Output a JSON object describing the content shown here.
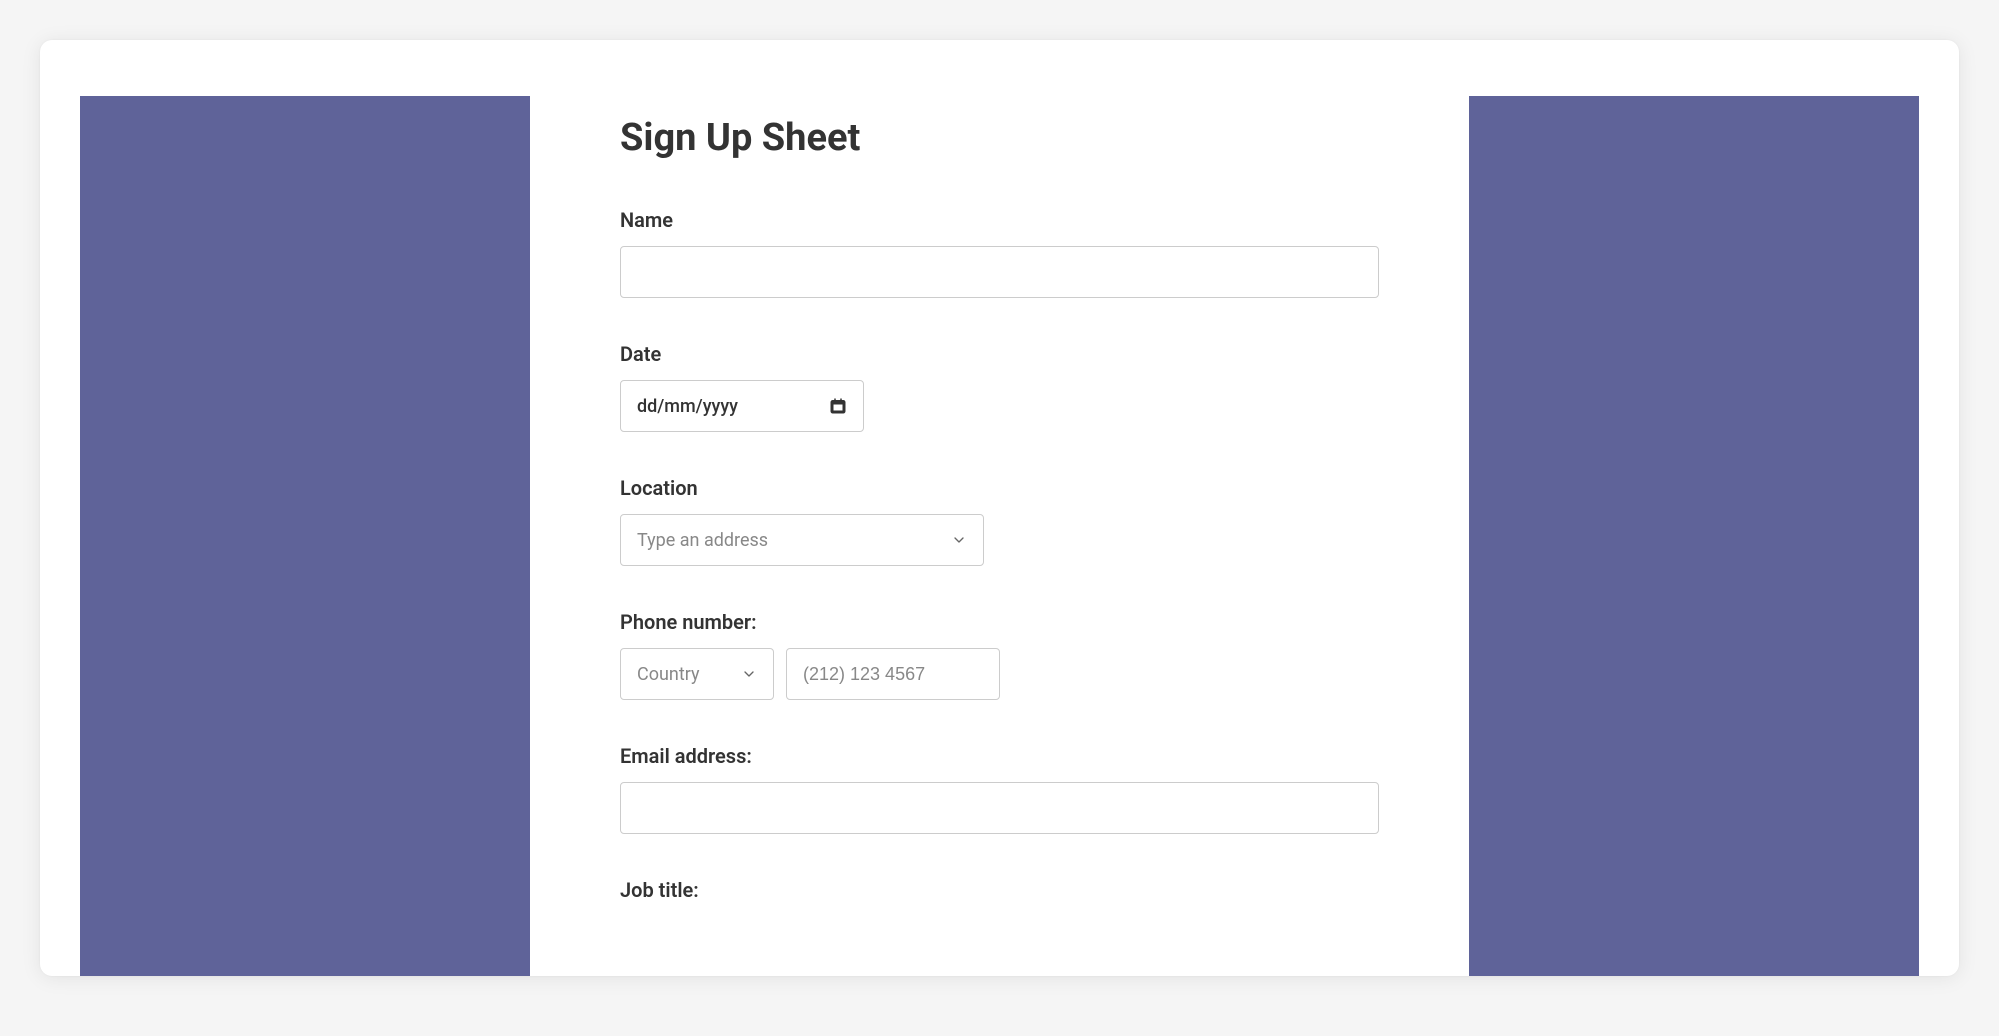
{
  "colors": {
    "sidePanel": "#5f6399"
  },
  "title": "Sign Up Sheet",
  "fields": {
    "name": {
      "label": "Name",
      "value": ""
    },
    "date": {
      "label": "Date",
      "placeholder": "dd/mm/yyyy",
      "value": ""
    },
    "location": {
      "label": "Location",
      "placeholder": "Type an address",
      "value": ""
    },
    "phone": {
      "label": "Phone number:",
      "countryPlaceholder": "Country",
      "countryValue": "",
      "numberPlaceholder": "(212) 123 4567",
      "numberValue": ""
    },
    "email": {
      "label": "Email address:",
      "value": ""
    },
    "jobTitle": {
      "label": "Job title:",
      "value": ""
    }
  }
}
